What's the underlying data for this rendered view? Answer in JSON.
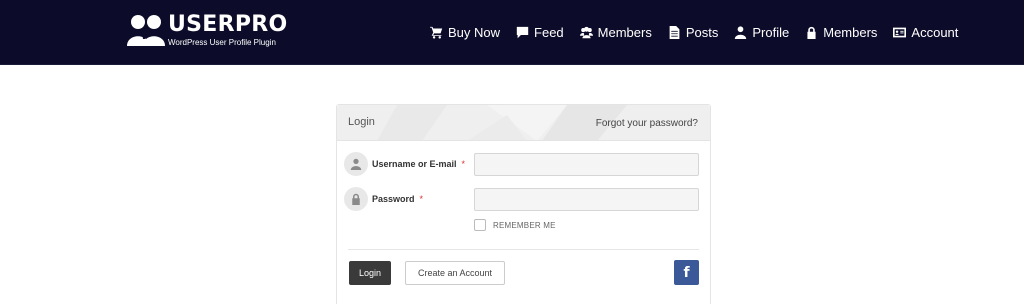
{
  "header": {
    "logo_title": "USERPRO",
    "logo_subtitle": "WordPress User Profile Plugin",
    "nav": [
      {
        "label": "Buy Now",
        "icon": "cart-icon"
      },
      {
        "label": "Feed",
        "icon": "comment-icon"
      },
      {
        "label": "Members",
        "icon": "group-icon"
      },
      {
        "label": "Posts",
        "icon": "document-icon"
      },
      {
        "label": "Profile",
        "icon": "user-icon"
      },
      {
        "label": "Members",
        "icon": "lock-icon"
      },
      {
        "label": "Account",
        "icon": "id-card-icon"
      }
    ]
  },
  "login": {
    "title": "Login",
    "forgot_link": "Forgot your password?",
    "username_label": "Username or E-mail",
    "password_label": "Password",
    "required_mark": "*",
    "username_value": "",
    "password_value": "",
    "remember_label": "REMEMBER ME",
    "remember_checked": false,
    "login_button": "Login",
    "create_account_button": "Create an Account",
    "facebook_button": "f"
  },
  "colors": {
    "header_bg": "#0c0c2a",
    "login_button_bg": "#3a3a3a",
    "facebook_bg": "#3b5998",
    "required": "#dd3333"
  }
}
